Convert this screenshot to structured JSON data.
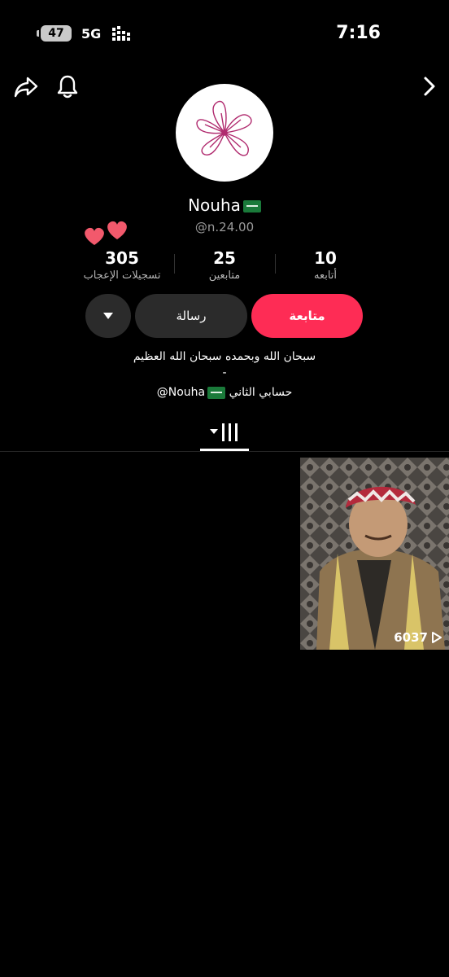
{
  "status_bar": {
    "time": "7:16",
    "battery": "47",
    "network": "5G"
  },
  "profile": {
    "display_name": "Nouha",
    "handle": "@n.24.00"
  },
  "stats": {
    "likes": {
      "value": "305",
      "label": "تسجيلات الإعجاب"
    },
    "followers": {
      "value": "25",
      "label": "متابعين"
    },
    "following": {
      "value": "10",
      "label": "أتابعه"
    }
  },
  "buttons": {
    "follow": "متابعة",
    "message": "رسالة"
  },
  "bio": {
    "line1": "سبحان الله وبحمده سبحان الله العظيم",
    "line2": "-",
    "line3_text": "حسابي الثاني",
    "line3_mention": "@Nouha"
  },
  "videos": [
    {
      "views": "6037"
    }
  ],
  "colors": {
    "accent": "#fe2c55",
    "background": "#000000",
    "button_dark": "#2b2b2b"
  },
  "icons": [
    "share-icon",
    "bell-icon",
    "chevron-right-icon",
    "hearts-icon",
    "dropdown-icon",
    "grid-tab-icon",
    "play-icon"
  ]
}
